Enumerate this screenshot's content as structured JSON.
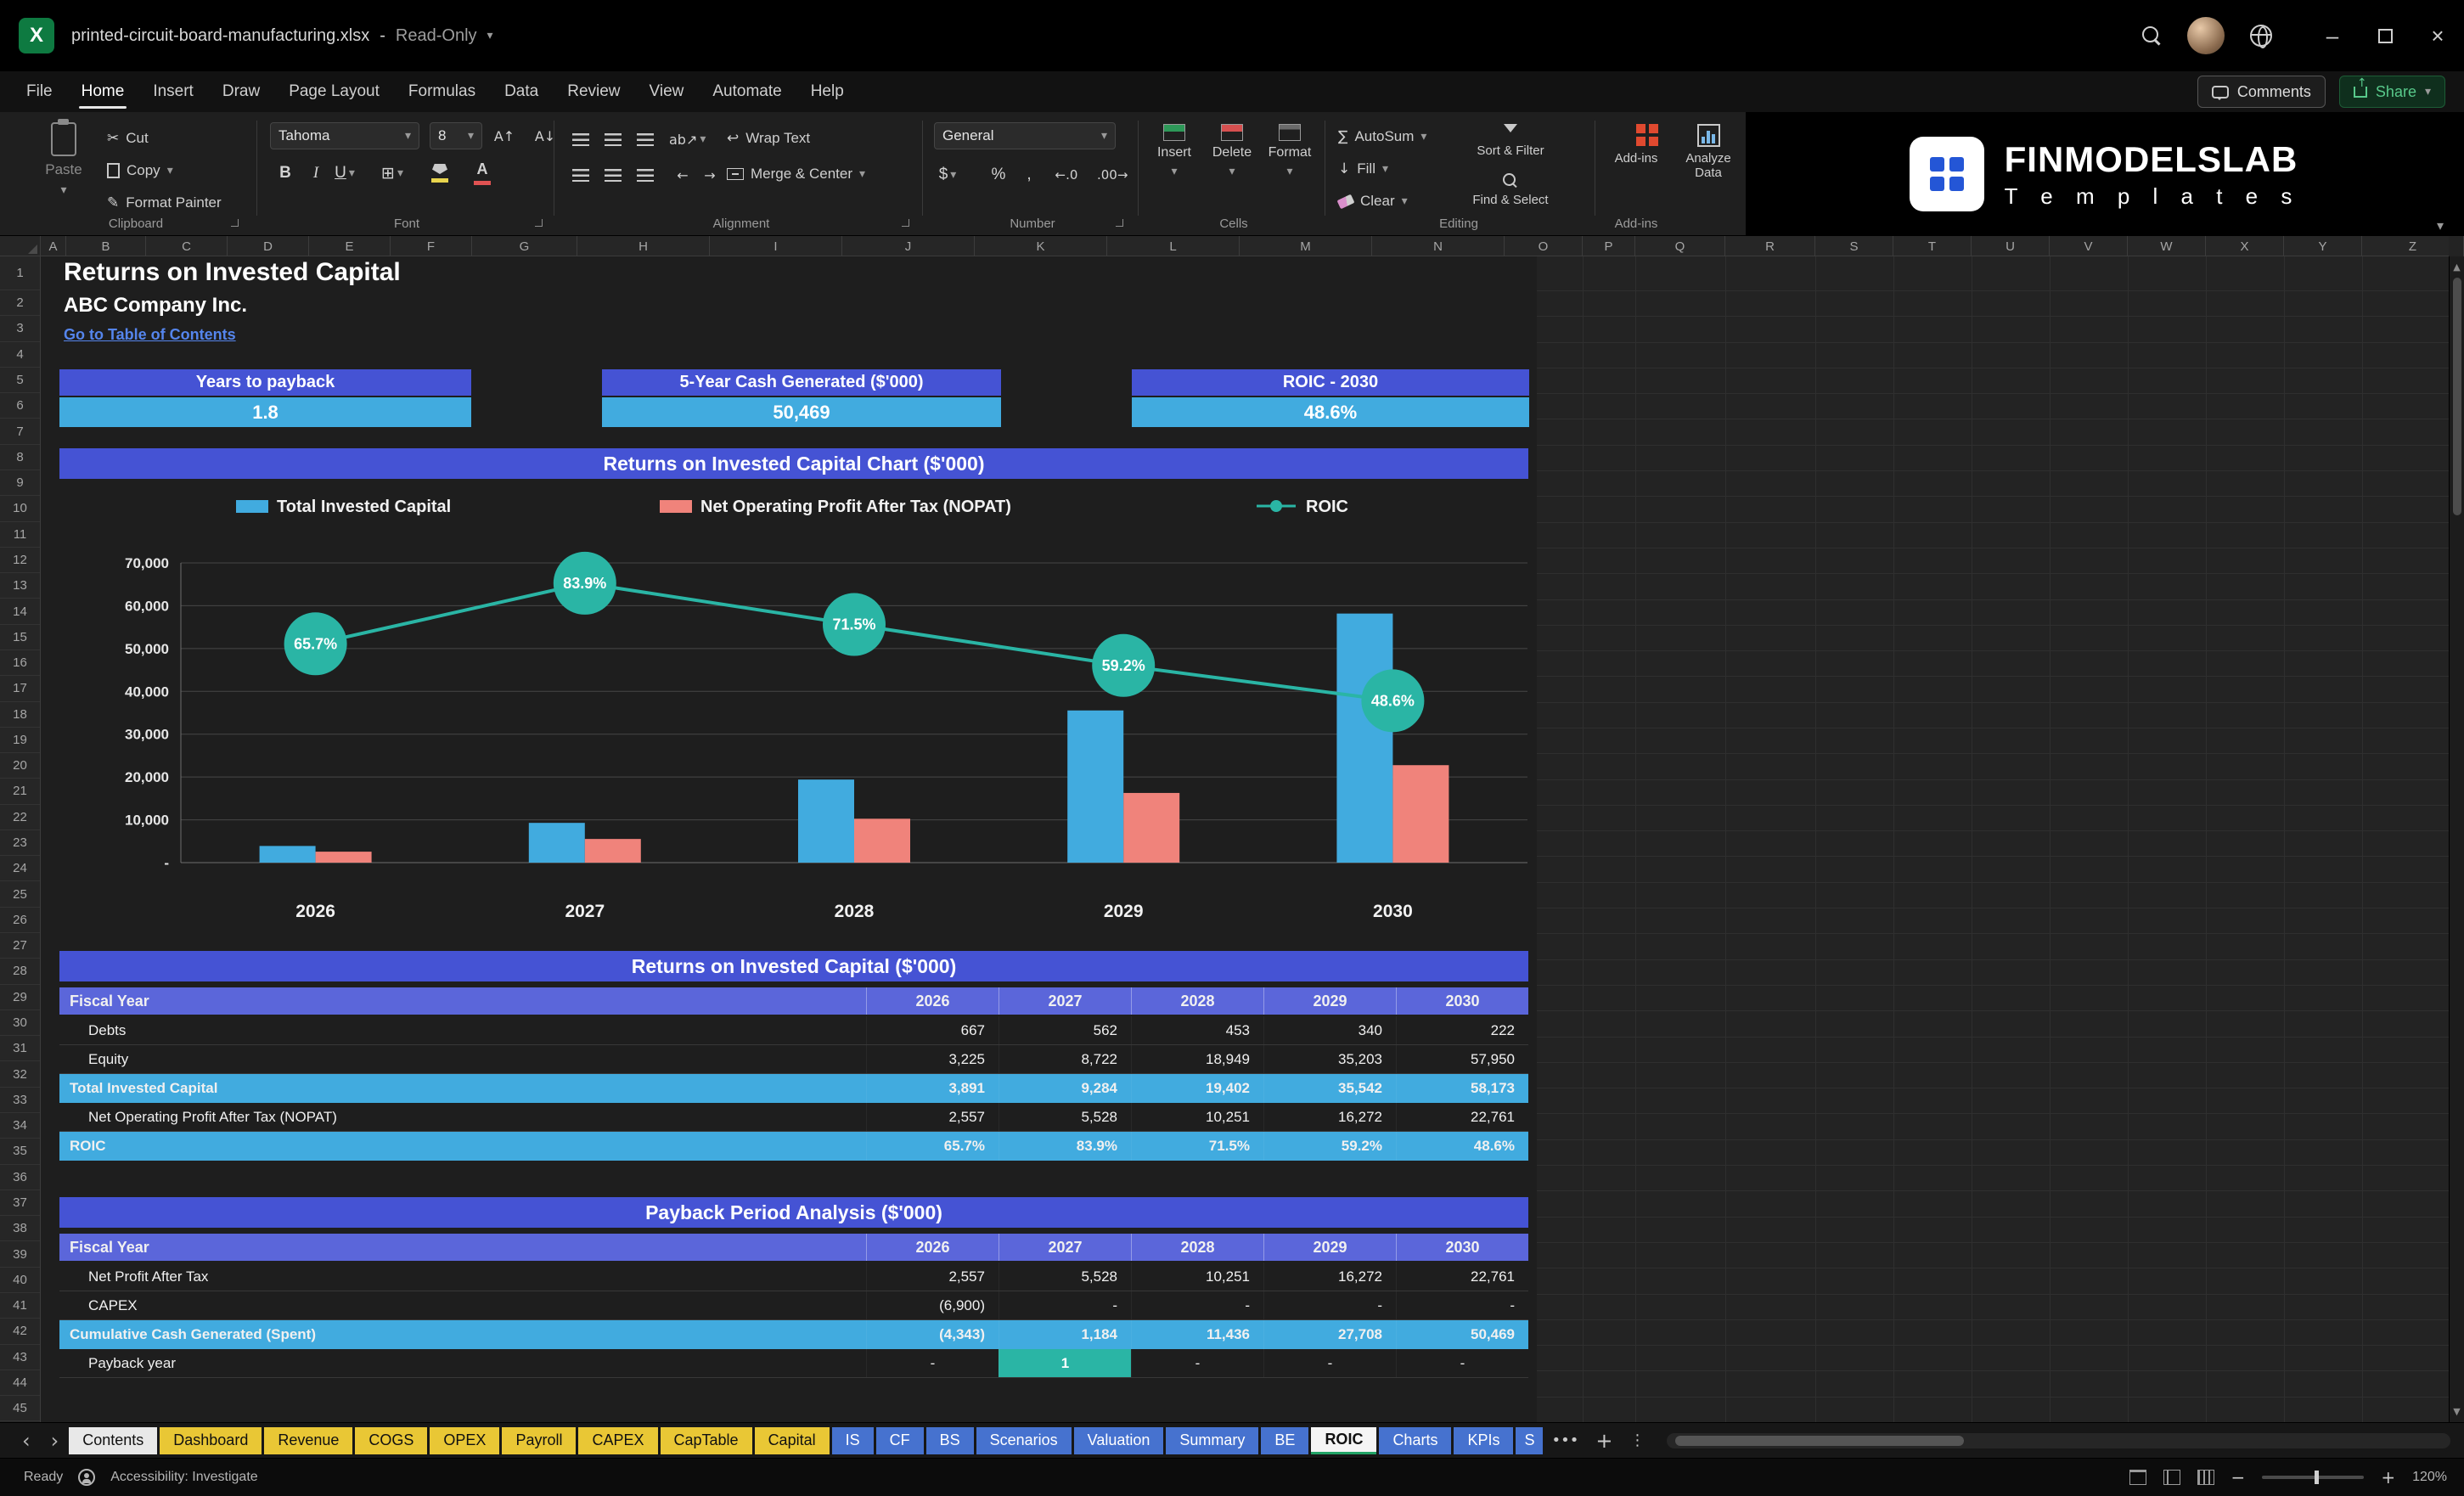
{
  "window": {
    "title": "printed-circuit-board-manufacturing.xlsx",
    "separator": "-",
    "mode": "Read-Only"
  },
  "icons": {
    "app": "X",
    "chevron_down": "▾",
    "nav_left": "‹",
    "nav_right": "›",
    "minimize": "–",
    "close": "×",
    "scissors": "✂",
    "pencil": "✎",
    "borders": "⊞",
    "sum": "∑",
    "down_arrow": "↓",
    "orientation": "ab↗",
    "wrap": "↩",
    "font_up": "A↑",
    "font_down": "A↓",
    "indent_out": "←",
    "indent_in": "→",
    "up_tri": "▲",
    "down_tri": "▼",
    "overflow": "•••",
    "more": "⋮",
    "add": "+",
    "zoom_minus": "−",
    "zoom_plus": "+"
  },
  "menu": {
    "items": [
      "File",
      "Home",
      "Insert",
      "Draw",
      "Page Layout",
      "Formulas",
      "Data",
      "Review",
      "View",
      "Automate",
      "Help"
    ],
    "active_index": 1,
    "comments": "Comments",
    "share": "Share"
  },
  "ribbon": {
    "clipboard": {
      "paste": "Paste",
      "cut": "Cut",
      "copy": "Copy",
      "format_painter": "Format Painter",
      "group": "Clipboard"
    },
    "font": {
      "family": "Tahoma",
      "size": "8",
      "bold": "B",
      "italic": "I",
      "underline": "U",
      "group": "Font"
    },
    "alignment": {
      "wrap_text": "Wrap Text",
      "merge_center": "Merge & Center",
      "group": "Alignment"
    },
    "number": {
      "format": "General",
      "currency": "$",
      "percent": "%",
      "comma": ",",
      "inc": "←.0",
      "dec": ".00→",
      "group": "Number"
    },
    "cells": {
      "insert": "Insert",
      "delete": "Delete",
      "format": "Format",
      "group": "Cells"
    },
    "editing": {
      "autosum": "AutoSum",
      "fill": "Fill",
      "clear": "Clear",
      "sort_filter": "Sort & Filter",
      "find_select": "Find & Select",
      "group": "Editing"
    },
    "addins": {
      "button": "Add-ins",
      "analyze": "Analyze Data",
      "group": "Add-ins"
    },
    "brand": {
      "name": "FINMODELSLAB",
      "sub": "T e m p l a t e s"
    }
  },
  "grid": {
    "columns": [
      "A",
      "B",
      "C",
      "D",
      "E",
      "F",
      "G",
      "H",
      "I",
      "J",
      "K",
      "L",
      "M",
      "N",
      "O",
      "P",
      "Q",
      "R",
      "S",
      "T",
      "U",
      "V",
      "W",
      "X",
      "Y",
      "Z"
    ],
    "row_start": 1,
    "row_end": 45
  },
  "content": {
    "title": "Returns on Invested Capital",
    "company": "ABC Company Inc.",
    "toc_link": "Go to Table of Contents",
    "kpis": [
      {
        "label": "Years to payback",
        "value": "1.8"
      },
      {
        "label": "5-Year Cash Generated ($'000)",
        "value": "50,469"
      },
      {
        "label": "ROIC - 2030",
        "value": "48.6%"
      }
    ]
  },
  "chart_data": {
    "type": "combo-bar-line",
    "title": "Returns on Invested Capital Chart ($'000)",
    "categories": [
      "2026",
      "2027",
      "2028",
      "2029",
      "2030"
    ],
    "series": [
      {
        "name": "Total Invested Capital",
        "type": "bar",
        "color": "#41abdf",
        "values": [
          3891,
          9284,
          19402,
          35542,
          58173
        ]
      },
      {
        "name": "Net Operating Profit After Tax (NOPAT)",
        "type": "bar",
        "color": "#f0837b",
        "values": [
          2557,
          5528,
          10251,
          16272,
          22761
        ]
      },
      {
        "name": "ROIC",
        "type": "line",
        "axis": "secondary",
        "color": "#2ab5a5",
        "values_pct": [
          65.7,
          83.9,
          71.5,
          59.2,
          48.6
        ],
        "labels": [
          "65.7%",
          "83.9%",
          "71.5%",
          "59.2%",
          "48.6%"
        ]
      }
    ],
    "ylim": [
      0,
      70000
    ],
    "y_ticks": [
      "70,000",
      "60,000",
      "50,000",
      "40,000",
      "30,000",
      "20,000",
      "10,000",
      "-"
    ],
    "secondary_ylim": [
      0,
      90
    ],
    "legend_position": "top",
    "gridlines": true
  },
  "roic_table": {
    "title": "Returns on Invested Capital ($'000)",
    "columns": [
      "Fiscal Year",
      "2026",
      "2027",
      "2028",
      "2029",
      "2030"
    ],
    "rows": [
      {
        "label": "Debts",
        "values": [
          "667",
          "562",
          "453",
          "340",
          "222"
        ],
        "style": "normal"
      },
      {
        "label": "Equity",
        "values": [
          "3,225",
          "8,722",
          "18,949",
          "35,203",
          "57,950"
        ],
        "style": "normal"
      },
      {
        "label": "Total Invested Capital",
        "values": [
          "3,891",
          "9,284",
          "19,402",
          "35,542",
          "58,173"
        ],
        "style": "highlight"
      },
      {
        "label": "Net Operating Profit After Tax (NOPAT)",
        "values": [
          "2,557",
          "5,528",
          "10,251",
          "16,272",
          "22,761"
        ],
        "style": "normal"
      },
      {
        "label": "ROIC",
        "values": [
          "65.7%",
          "83.9%",
          "71.5%",
          "59.2%",
          "48.6%"
        ],
        "style": "highlight"
      }
    ]
  },
  "payback_table": {
    "title": "Payback Period Analysis ($'000)",
    "columns": [
      "Fiscal Year",
      "2026",
      "2027",
      "2028",
      "2029",
      "2030"
    ],
    "rows": [
      {
        "label": "Net Profit After Tax",
        "values": [
          "2,557",
          "5,528",
          "10,251",
          "16,272",
          "22,761"
        ],
        "style": "normal"
      },
      {
        "label": "CAPEX",
        "values": [
          "(6,900)",
          "-",
          "-",
          "-",
          "-"
        ],
        "style": "normal"
      },
      {
        "label": "Cumulative Cash Generated (Spent)",
        "values": [
          "(4,343)",
          "1,184",
          "11,436",
          "27,708",
          "50,469"
        ],
        "style": "highlight"
      },
      {
        "label": "Payback year",
        "values": [
          "-",
          "1",
          "-",
          "-",
          "-"
        ],
        "style": "normal",
        "align": "center",
        "highlight_cells": [
          1
        ]
      }
    ]
  },
  "sheet_tabs": {
    "tabs": [
      {
        "label": "Contents",
        "type": "light"
      },
      {
        "label": "Dashboard",
        "type": "yellow"
      },
      {
        "label": "Revenue",
        "type": "yellow"
      },
      {
        "label": "COGS",
        "type": "yellow"
      },
      {
        "label": "OPEX",
        "type": "yellow"
      },
      {
        "label": "Payroll",
        "type": "yellow"
      },
      {
        "label": "CAPEX",
        "type": "yellow"
      },
      {
        "label": "CapTable",
        "type": "yellow"
      },
      {
        "label": "Capital",
        "type": "yellow"
      },
      {
        "label": "IS",
        "type": "blue"
      },
      {
        "label": "CF",
        "type": "blue"
      },
      {
        "label": "BS",
        "type": "blue"
      },
      {
        "label": "Scenarios",
        "type": "blue"
      },
      {
        "label": "Valuation",
        "type": "blue"
      },
      {
        "label": "Summary",
        "type": "blue"
      },
      {
        "label": "BE",
        "type": "blue"
      },
      {
        "label": "ROIC",
        "type": "active"
      },
      {
        "label": "Charts",
        "type": "blue"
      },
      {
        "label": "KPIs",
        "type": "blue"
      },
      {
        "label": "S",
        "type": "blue",
        "partial": true
      }
    ]
  },
  "status": {
    "left": "Ready",
    "accessibility": "Accessibility: Investigate",
    "zoom": "120%"
  },
  "colors": {
    "band_blue": "#4553d4",
    "header_blue": "#5b66da",
    "accent_blue": "#41abdf",
    "salmon": "#f0837b",
    "teal": "#2ab5a5",
    "link": "#5585ec",
    "tab_yellow": "#e9c735",
    "tab_blue": "#4672cf",
    "active_green": "#21a366",
    "excel_green": "#0e7a41",
    "share_green": "#58c98b"
  }
}
